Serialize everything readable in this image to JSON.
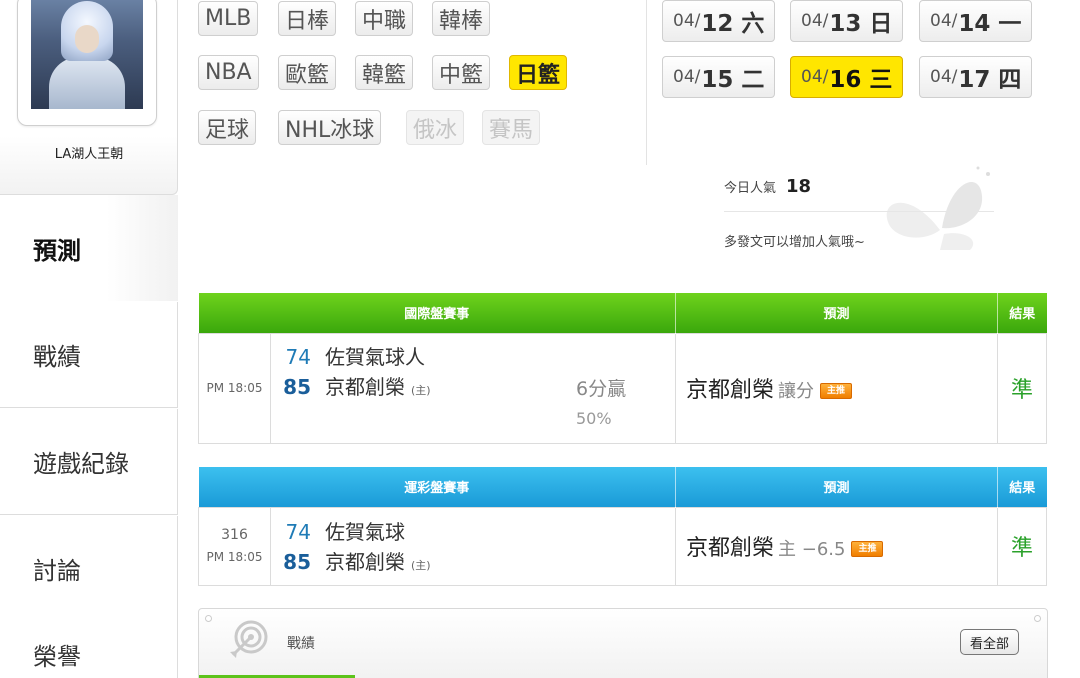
{
  "profile": {
    "name": "LA湖人王朝"
  },
  "nav": [
    {
      "label": "預測",
      "active": true
    },
    {
      "label": "戰績"
    },
    {
      "label": "遊戲紀錄"
    },
    {
      "label": "討論"
    },
    {
      "label": "榮譽"
    }
  ],
  "sports": {
    "row1": [
      "MLB",
      "日棒",
      "中職",
      "韓棒"
    ],
    "row2": [
      "NBA",
      "歐籃",
      "韓籃",
      "中籃",
      "日籃"
    ],
    "row3": [
      "足球",
      "NHL冰球",
      "俄冰",
      "賽馬"
    ],
    "selected": "日籃",
    "disabled": [
      "俄冰",
      "賽馬"
    ]
  },
  "dates": [
    {
      "prefix": "04/",
      "day": "12 六"
    },
    {
      "prefix": "04/",
      "day": "13 日"
    },
    {
      "prefix": "04/",
      "day": "14 一"
    },
    {
      "prefix": "04/",
      "day": "15 二"
    },
    {
      "prefix": "04/",
      "day": "16 三",
      "selected": true
    },
    {
      "prefix": "04/",
      "day": "17 四"
    }
  ],
  "popularity": {
    "label": "今日人氣",
    "value": "18",
    "hint": "多發文可以增加人氣哦~"
  },
  "intl": {
    "headers": {
      "match": "國際盤賽事",
      "prediction": "預測",
      "result": "結果"
    },
    "row": {
      "time": "PM 18:05",
      "away_score": "74",
      "away_team": "佐賀氣球人",
      "home_score": "85",
      "home_team": "京都創榮",
      "home_mark": "(主)",
      "spread": "6分贏",
      "percent": "50%",
      "prediction_team": "京都創榮",
      "prediction_type": "讓分",
      "badge": "主推",
      "result": "準"
    }
  },
  "sportslottery": {
    "headers": {
      "match": "運彩盤賽事",
      "prediction": "預測",
      "result": "結果"
    },
    "row": {
      "code": "316",
      "time": "PM 18:05",
      "away_score": "74",
      "away_team": "佐賀氣球",
      "home_score": "85",
      "home_team": "京都創榮",
      "home_mark": "(主)",
      "prediction_team": "京都創榮",
      "prediction_type": "主 −6.5",
      "badge": "主推",
      "result": "準"
    }
  },
  "record_panel": {
    "title": "戰績",
    "view_all": "看全部"
  },
  "colors": {
    "green_header": "#3aa70c",
    "blue_header": "#1a9ad7",
    "selected": "#ffe600",
    "result": "#2aa12a"
  }
}
